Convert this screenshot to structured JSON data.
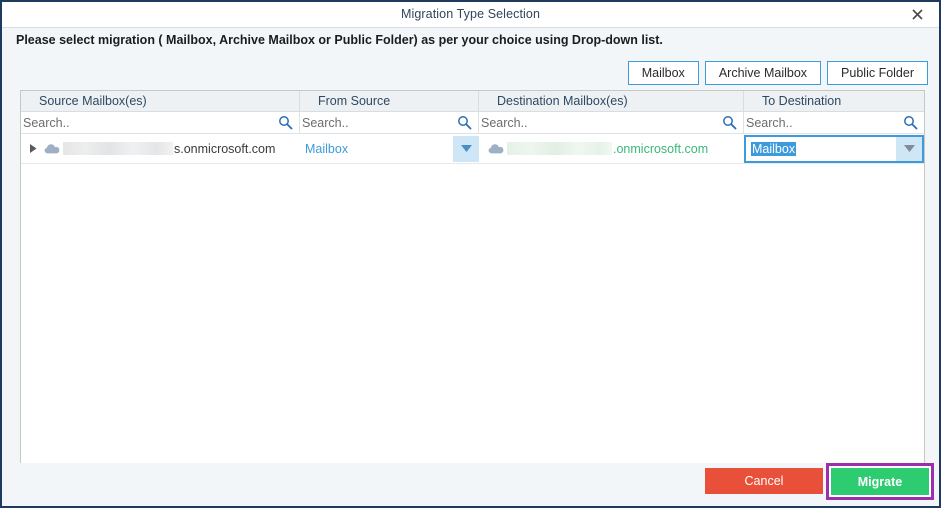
{
  "window": {
    "title": "Migration Type Selection",
    "close_icon": "close-icon"
  },
  "instruction": {
    "text": "Please select migration ( Mailbox, Archive Mailbox or Public Folder) as per your choice using Drop-down list."
  },
  "type_buttons": [
    {
      "label": "Mailbox",
      "name": "mailbox-button"
    },
    {
      "label": "Archive Mailbox",
      "name": "archive-mailbox-button"
    },
    {
      "label": "Public Folder",
      "name": "public-folder-button"
    }
  ],
  "grid": {
    "columns": [
      {
        "header": "Source Mailbox(es)",
        "search_placeholder": "Search.."
      },
      {
        "header": "From Source",
        "search_placeholder": "Search.."
      },
      {
        "header": "Destination Mailbox(es)",
        "search_placeholder": "Search.."
      },
      {
        "header": "To Destination",
        "search_placeholder": "Search.."
      }
    ],
    "rows": [
      {
        "source_domain": "s.onmicrosoft.com",
        "source_redacted": true,
        "from_source_value": "Mailbox",
        "destination_domain": ".onmicrosoft.com",
        "destination_redacted": true,
        "to_destination_value": "Mailbox",
        "to_destination_focused": true
      }
    ]
  },
  "footer": {
    "cancel_label": "Cancel",
    "migrate_label": "Migrate"
  },
  "colors": {
    "accent_blue": "#3d9bdc",
    "title_text": "#31455c",
    "cancel_red": "#e8503a",
    "migrate_green": "#2ecc71",
    "highlight_purple": "#9b2fb0",
    "destination_green": "#3bb878",
    "window_border": "#1f3a5f"
  }
}
